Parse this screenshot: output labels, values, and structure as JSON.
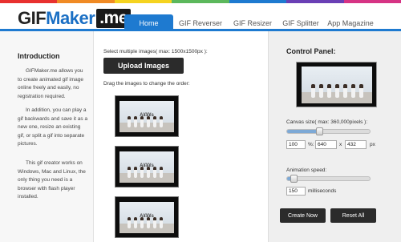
{
  "rainbow_colors": [
    "#e8312f",
    "#f08a24",
    "#f5d31f",
    "#5cb85c",
    "#1e7ad0",
    "#6a3fb5",
    "#d63384"
  ],
  "accent_color": "#1e7ad0",
  "logo": {
    "part1": "GIF",
    "part2": "Maker",
    "part3": ".me"
  },
  "nav": [
    {
      "label": "Home"
    },
    {
      "label": "GIF Reverser"
    },
    {
      "label": "GIF Resizer"
    },
    {
      "label": "GIF Splitter"
    },
    {
      "label": "App Magazine"
    }
  ],
  "intro": {
    "title": "Introduction",
    "paragraphs": [
      "GIFMaker.me allows you to create animated gif image online freely and easily, no registration required.",
      "In addition, you can play a gif backwards and save it as a new one, resize an existing gif, or split a gif into separate pictures.",
      "This gif creator works on Windows, Mac and Linux, the only thing you need is a browser with flash player installed."
    ]
  },
  "upload": {
    "hint": "Select multiple images( max: 1500x1500px ):",
    "button": "Upload Images",
    "drag_hint": "Drag the images to change the order:"
  },
  "thumbs": [
    {
      "caption": "A¥¥¥s"
    },
    {
      "caption": "A¥¥¥s"
    },
    {
      "caption": "A¥¥¥s"
    }
  ],
  "control_panel": {
    "title": "Control Panel:",
    "canvas_label": "Canvas size( max: 360,000pixels ):",
    "canvas_slider_level": 0.38,
    "percent_value": "100",
    "percent_unit": "%:",
    "width_value": "640",
    "x_sep": "x",
    "height_value": "432",
    "px_unit": "px",
    "speed_label": "Animation speed:",
    "speed_slider_level": 0.04,
    "speed_value": "150",
    "speed_unit": "milliseconds",
    "create_button": "Create Now",
    "reset_button": "Reset All"
  }
}
